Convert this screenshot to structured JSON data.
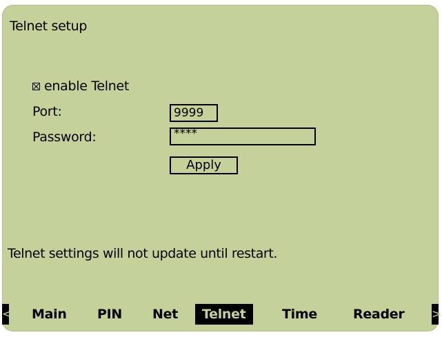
{
  "screen": {
    "title": "Telnet setup",
    "enable_checkbox": {
      "label": "enable Telnet",
      "checked": true
    },
    "port": {
      "label": "Port:",
      "value": "9999"
    },
    "password": {
      "label": "Password:",
      "value": "****"
    },
    "apply_label": "Apply",
    "note": "Telnet settings will not update until restart."
  },
  "nav": {
    "prev_icon": "<",
    "next_icon": ">",
    "items": [
      "Main",
      "PIN",
      "Net",
      "Telnet",
      "Time",
      "Reader"
    ],
    "active": "Telnet"
  },
  "colors": {
    "background": "#c4d19b",
    "foreground": "#000000"
  }
}
